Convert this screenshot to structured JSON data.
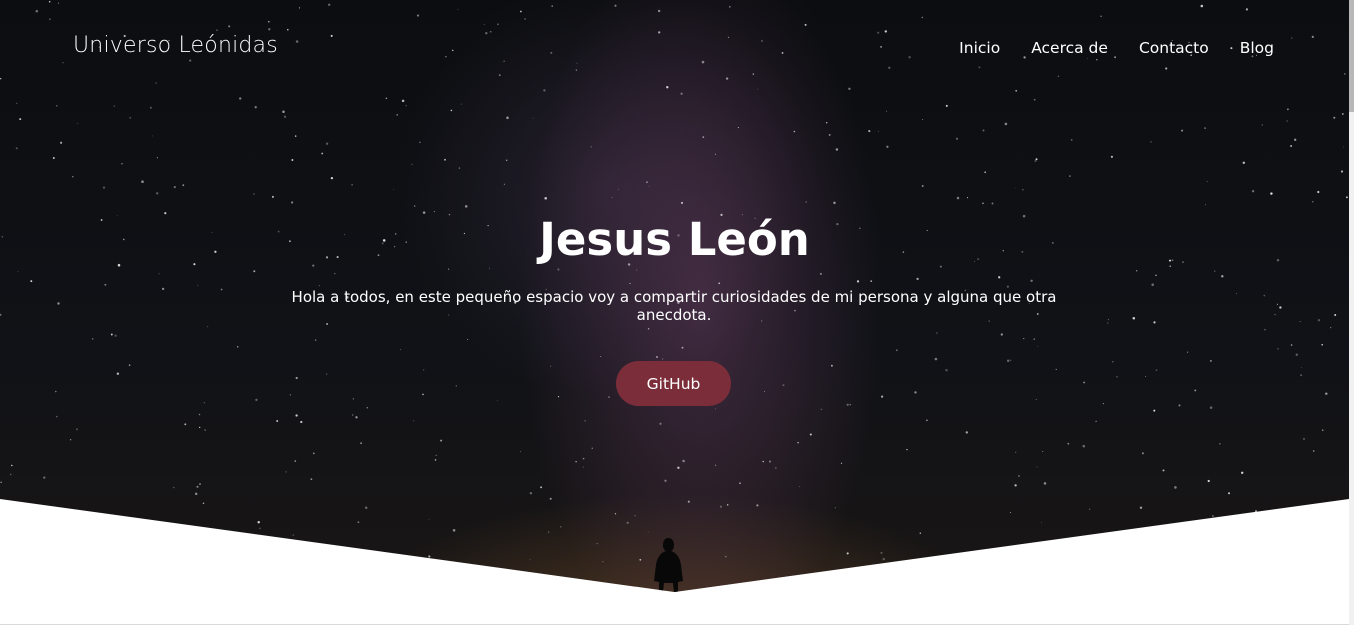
{
  "navbar": {
    "brand": "Universo Leónidas",
    "links": [
      "Inicio",
      "Acerca de",
      "Contacto",
      "Blog"
    ]
  },
  "hero": {
    "title": "Jesus León",
    "description": "Hola a todos, en este pequeño espacio voy a compartir curiosidades de mi persona y alguna que otra anecdota.",
    "button_label": "GitHub"
  },
  "colors": {
    "accent": "#7b2e3a",
    "hero_background": "#0f1115",
    "text": "#ffffff"
  }
}
